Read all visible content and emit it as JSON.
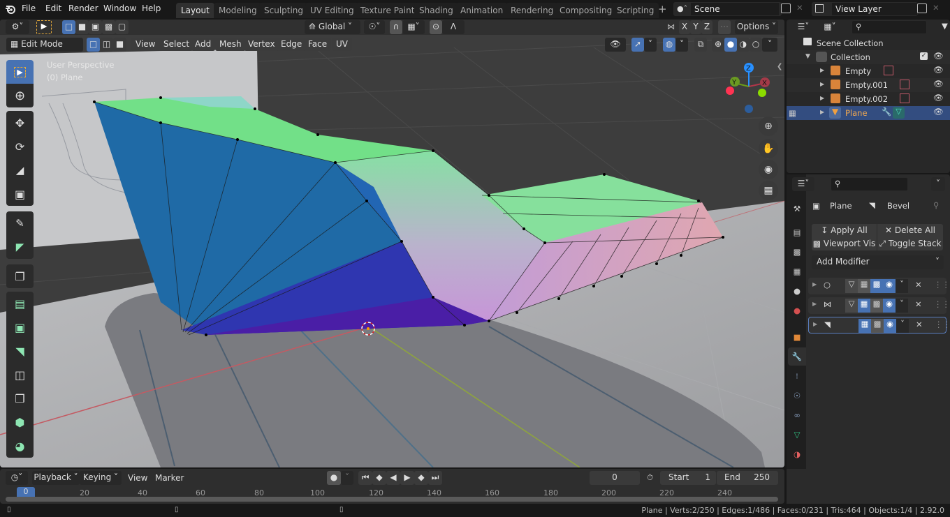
{
  "menu": {
    "file": "File",
    "edit": "Edit",
    "render": "Render",
    "window": "Window",
    "help": "Help"
  },
  "workspaces": [
    "Layout",
    "Modeling",
    "Sculpting",
    "UV Editing",
    "Texture Paint",
    "Shading",
    "Animation",
    "Rendering",
    "Compositing",
    "Scripting"
  ],
  "active_workspace": "Layout",
  "scene": {
    "name": "Scene",
    "view_layer": "View Layer"
  },
  "viewport": {
    "mode": "Edit Mode",
    "header_menus": [
      "View",
      "Select",
      "Add",
      "Mesh",
      "Vertex",
      "Edge",
      "Face",
      "UV"
    ],
    "transform_orientation": "Global",
    "axis_labels": [
      "X",
      "Y",
      "Z"
    ],
    "options_label": "Options",
    "overlay_title": "User Perspective",
    "overlay_object": "(0) Plane",
    "gizmo": {
      "x": "X",
      "y": "Y",
      "z": "Z"
    },
    "colors": {
      "x_axis": "#ff3352",
      "y_axis": "#8bdc00",
      "z_axis": "#2890ff",
      "accent": "#4772b3"
    }
  },
  "outliner": {
    "root": "Scene Collection",
    "collection": "Collection",
    "items": [
      {
        "name": "Empty",
        "type": "empty"
      },
      {
        "name": "Empty.001",
        "type": "empty"
      },
      {
        "name": "Empty.002",
        "type": "empty"
      },
      {
        "name": "Plane",
        "type": "mesh",
        "selected": true
      }
    ]
  },
  "properties": {
    "breadcrumb_object": "Plane",
    "breadcrumb_modifier": "Bevel",
    "apply_all": "Apply All",
    "delete_all": "Delete All",
    "viewport_vis": "Viewport Vis",
    "toggle_stack": "Toggle Stack",
    "add_modifier": "Add Modifier",
    "modifiers": [
      {
        "icon": "subdivision-icon"
      },
      {
        "icon": "mirror-icon"
      },
      {
        "icon": "bevel-icon"
      }
    ]
  },
  "timeline": {
    "menus": [
      "Playback",
      "Keying",
      "View",
      "Marker"
    ],
    "current_frame": "0",
    "start_label": "Start",
    "start": "1",
    "end_label": "End",
    "end": "250",
    "ruler": [
      "0",
      "20",
      "40",
      "60",
      "80",
      "100",
      "120",
      "140",
      "160",
      "180",
      "200",
      "220",
      "240"
    ]
  },
  "status": {
    "text": "Plane | Verts:2/250 | Edges:1/486 | Faces:0/231 | Tris:464 | Objects:1/4 | 2.92.0"
  }
}
